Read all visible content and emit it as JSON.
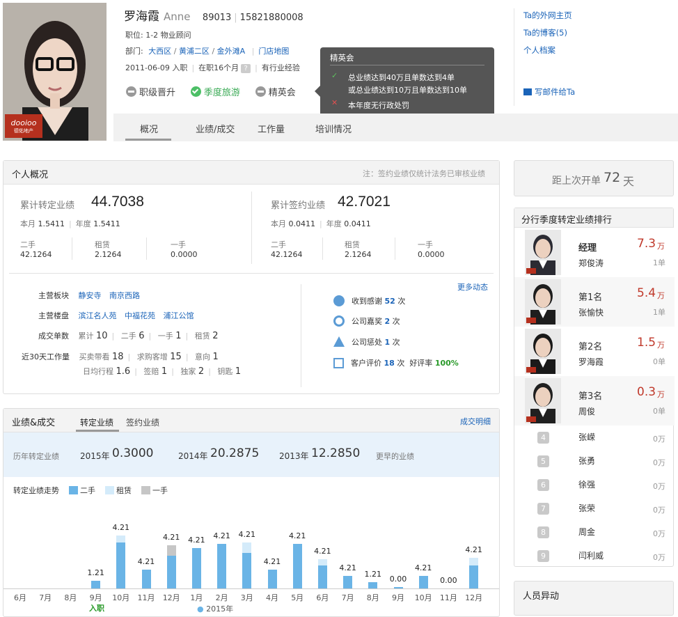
{
  "profile": {
    "name": "罗海霞",
    "en_name": "Anne",
    "emp_id": "89013",
    "phone": "15821880008",
    "position": "职位:  1-2 物业顾问",
    "dept_label": "部门:",
    "dept": [
      "大西区",
      "黄浦二区",
      "金外滩A"
    ],
    "store_map": "门店地图",
    "join_date": "2011-06-09 入职",
    "tenure": "在职16个月",
    "help": "?",
    "experience": "有行业经验",
    "logo": "dooioo",
    "logo_sub": "德佑地产"
  },
  "badges": [
    {
      "label": "职级晋升",
      "state": "off"
    },
    {
      "label": "季度旅游",
      "state": "on"
    },
    {
      "label": "精英会",
      "state": "off"
    }
  ],
  "tooltip": {
    "title": "精英会",
    "line1": "总业绩达到40万且单数达到4单",
    "line2": "或总业绩达到10万且单数达到10单",
    "line3": "本年度无行政处罚",
    "colors": {
      "ok": "#5ec25e",
      "no": "#e05050"
    }
  },
  "right_links": {
    "home": "Ta的外网主页",
    "blog": "Ta的博客(5)",
    "archive": "个人档案",
    "mail": "写邮件给Ta"
  },
  "tabs": [
    "概况",
    "业绩/成交",
    "工作量",
    "培训情况"
  ],
  "overview": {
    "title": "个人概况",
    "note": "注：签约业绩仅统计法务已审核业绩",
    "left": {
      "label": "累计转定业绩",
      "value": "44.7038",
      "month": "本月",
      "month_v": "1.5411",
      "year": "年度",
      "year_v": "1.5411",
      "cols": [
        {
          "k": "二手",
          "v": "42.1264"
        },
        {
          "k": "租赁",
          "v": "2.1264"
        },
        {
          "k": "一手",
          "v": "0.0000"
        }
      ]
    },
    "right": {
      "label": "累计签约业绩",
      "value": "42.7021",
      "month": "本月",
      "month_v": "0.0411",
      "year": "年度",
      "year_v": "0.0411",
      "cols": [
        {
          "k": "二手",
          "v": "42.1264"
        },
        {
          "k": "租赁",
          "v": "2.1264"
        },
        {
          "k": "一手",
          "v": "0.0000"
        }
      ]
    },
    "more": "更多动态",
    "block_label": "主营板块",
    "blocks": [
      "静安寺",
      "南京西路"
    ],
    "estate_label": "主营楼盘",
    "estates": [
      "滨江名人苑",
      "中福花苑",
      "浦江公馆"
    ],
    "deals_label": "成交单数",
    "deals": [
      {
        "k": "累计",
        "v": "10"
      },
      {
        "k": "二手",
        "v": "6"
      },
      {
        "k": "一手",
        "v": "1"
      },
      {
        "k": "租赁",
        "v": "2"
      }
    ],
    "work_label": "近30天工作量",
    "work1": [
      {
        "k": "买卖带看",
        "v": "18"
      },
      {
        "k": "求购客增",
        "v": "15"
      },
      {
        "k": "意向",
        "v": "1"
      }
    ],
    "work2": [
      {
        "k": "日均行程",
        "v": "1.6"
      },
      {
        "k": "签赔",
        "v": "1"
      },
      {
        "k": "独家",
        "v": "2"
      },
      {
        "k": "钥匙",
        "v": "1"
      }
    ],
    "events": [
      {
        "pre": "收到感谢",
        "n": "52",
        "post": "次"
      },
      {
        "pre": "公司嘉奖",
        "n": "2",
        "post": "次"
      },
      {
        "pre": "公司惩处",
        "n": "1",
        "post": "次"
      },
      {
        "pre": "客户评价",
        "n": "18",
        "post": "次",
        "extra": "好评率",
        "pct": "100%"
      }
    ]
  },
  "perf": {
    "title": "业绩&成交",
    "tab1": "转定业绩",
    "tab2": "签约业绩",
    "detail": "成交明细",
    "hist_label": "历年转定业绩",
    "years": [
      {
        "y": "2015年",
        "v": "0.3000"
      },
      {
        "y": "2014年",
        "v": "20.2875"
      },
      {
        "y": "2013年",
        "v": "12.2850"
      }
    ],
    "earlier": "更早的业绩",
    "trend_label": "转定业绩走势",
    "legend": [
      "二手",
      "租赁",
      "一手"
    ],
    "join_mark": "入职",
    "year_mark": "2015年"
  },
  "chart_data": {
    "type": "bar",
    "categories": [
      "6月",
      "7月",
      "8月",
      "9月",
      "10月",
      "11月",
      "12月",
      "1月",
      "2月",
      "3月",
      "4月",
      "5月",
      "6月",
      "7月",
      "8月",
      "9月",
      "10月",
      "11月",
      "12月"
    ],
    "series": [
      {
        "name": "二手",
        "values": [
          0,
          0,
          0,
          0.6,
          3.6,
          1.5,
          2.6,
          3.2,
          3.5,
          2.8,
          1.5,
          3.5,
          1.8,
          1.0,
          0.5,
          0.1,
          1.0,
          0,
          1.8
        ]
      },
      {
        "name": "租赁",
        "values": [
          0,
          0,
          0,
          0,
          0.6,
          0,
          0,
          0,
          0,
          0.8,
          0,
          0,
          0.5,
          0,
          0,
          0,
          0,
          0,
          0.6
        ]
      },
      {
        "name": "一手",
        "values": [
          0,
          0,
          0,
          0,
          0,
          0,
          0.8,
          0,
          0,
          0,
          0,
          0,
          0,
          0,
          0,
          0,
          0,
          0,
          0
        ]
      }
    ],
    "labels": [
      "",
      "",
      "",
      "1.21",
      "4.21",
      "4.21",
      "4.21",
      "4.21",
      "4.21",
      "4.21",
      "4.21",
      "4.21",
      "4.21",
      "4.21",
      "1.21",
      "0.00",
      "4.21",
      "0.00",
      "4.21"
    ]
  },
  "days": {
    "label": "距上次开单",
    "value": "72",
    "unit": "天"
  },
  "ranking": {
    "title": "分行季度转定业绩排行",
    "top": [
      {
        "rank": "经理",
        "name": "郑俊涛",
        "amt": "7.3",
        "unit": "万",
        "deals": "1单"
      },
      {
        "rank": "第1名",
        "name": "张愉快",
        "amt": "5.4",
        "unit": "万",
        "deals": "1单"
      },
      {
        "rank": "第2名",
        "name": "罗海霞",
        "amt": "1.5",
        "unit": "万",
        "deals": "0单"
      },
      {
        "rank": "第3名",
        "name": "周俊",
        "amt": "0.3",
        "unit": "万",
        "deals": "0单"
      }
    ],
    "rest": [
      {
        "n": "4",
        "name": "张嵘",
        "amt": "0万"
      },
      {
        "n": "5",
        "name": "张勇",
        "amt": "0万"
      },
      {
        "n": "6",
        "name": "徐强",
        "amt": "0万"
      },
      {
        "n": "7",
        "name": "张荣",
        "amt": "0万"
      },
      {
        "n": "8",
        "name": "周金",
        "amt": "0万"
      },
      {
        "n": "9",
        "name": "闫利威",
        "amt": "0万"
      }
    ]
  },
  "changes": {
    "title": "人员异动"
  }
}
